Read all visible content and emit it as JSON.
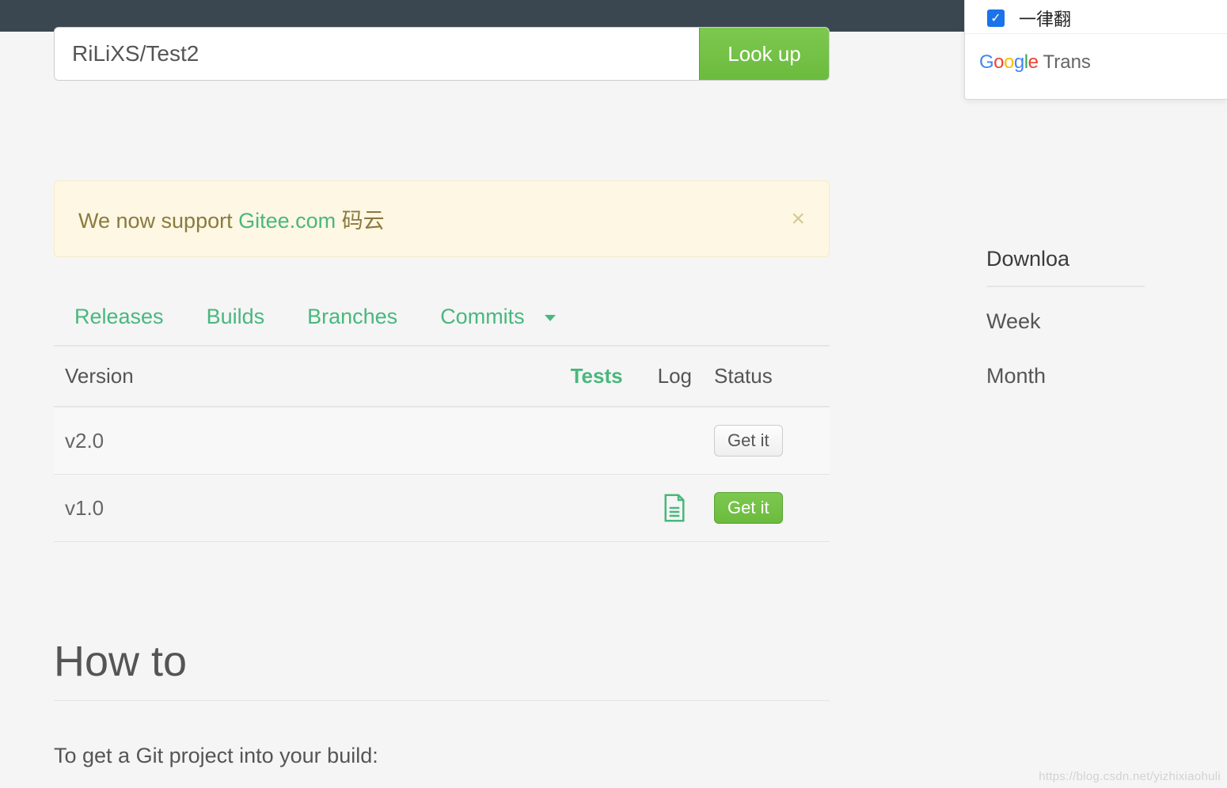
{
  "search": {
    "value": "RiLiXS/Test2",
    "button": "Look up"
  },
  "alert": {
    "prefix": "We now support ",
    "link": "Gitee.com",
    "suffix": " 码云",
    "close": "×"
  },
  "tabs": {
    "releases": "Releases",
    "builds": "Builds",
    "branches": "Branches",
    "commits": "Commits"
  },
  "table": {
    "headers": {
      "version": "Version",
      "tests": "Tests",
      "log": "Log",
      "status": "Status"
    },
    "rows": [
      {
        "version": "v2.0",
        "tests": "",
        "has_log": false,
        "status_label": "Get it",
        "status_style": "default"
      },
      {
        "version": "v1.0",
        "tests": "",
        "has_log": true,
        "status_label": "Get it",
        "status_style": "success"
      }
    ]
  },
  "howto": {
    "title": "How to",
    "line1": "To get a Git project into your build:"
  },
  "sidebar": {
    "title": "Downloa",
    "week": "Week",
    "month": "Month"
  },
  "translate": {
    "checkbox_label": "一律翻",
    "brand": "Google",
    "trans_label": "Trans"
  },
  "watermark": "https://blog.csdn.net/yizhixiaohuli"
}
